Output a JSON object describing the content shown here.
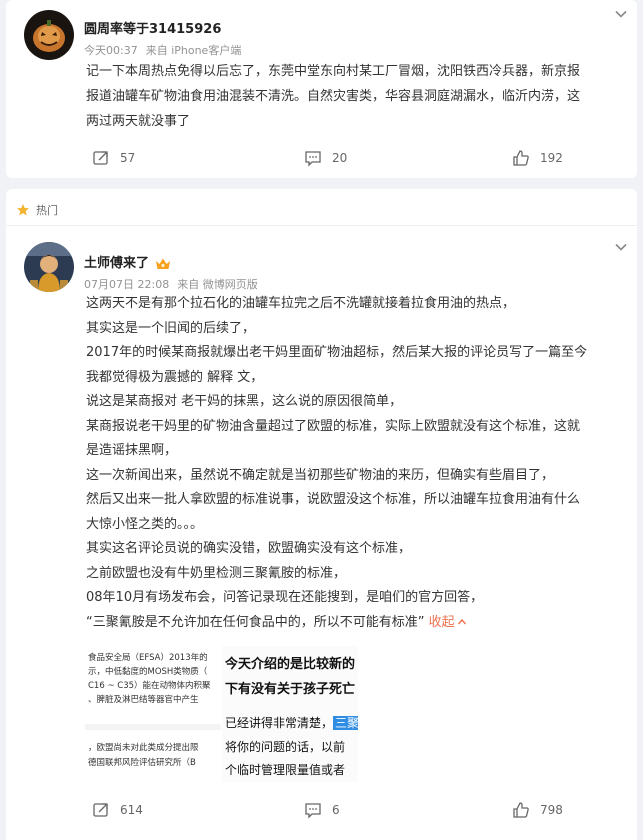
{
  "post1": {
    "username": "圆周率等于31415926",
    "time": "今天00:37",
    "source": "来自 iPhone客户端",
    "lines": [
      "记一下本周热点免得以后忘了，东莞中堂东向村某工厂冒烟，沈阳铁西冷兵器，新京报",
      "报道油罐车矿物油食用油混装不清洗。自然灾害类，华容县洞庭湖漏水，临沂内涝，这",
      "两过两天就没事了"
    ],
    "repost_count": "57",
    "comment_count": "20",
    "like_count": "192"
  },
  "hot_label": "热门",
  "post2": {
    "username": "土师傅来了",
    "time": "07月07日 22:08",
    "source": "来自 微博网页版",
    "lines": [
      "这两天不是有那个拉石化的油罐车拉完之后不洗罐就接着拉食用油的热点，",
      "其实这是一个旧闻的后续了，",
      "2017年的时候某商报就爆出老干妈里面矿物油超标，然后某大报的评论员写了一篇至今",
      "我都觉得极为震撼的 解释 文，",
      "说这是某商报对 老干妈的抹黑，这么说的原因很简单，",
      "某商报说老干妈里的矿物油含量超过了欧盟的标准，实际上欧盟就没有这个标准，这就",
      "是造谣抹黑啊，",
      "这一次新闻出来，虽然说不确定就是当初那些矿物油的来历，但确实有些眉目了，",
      "然后又出来一批人拿欧盟的标准说事，说欧盟没这个标准，所以油罐车拉食用油有什么",
      "大惊小怪之类的。。。",
      "其实这名评论员说的确实没错，欧盟确实没有这个标准，",
      "之前欧盟也没有牛奶里检测三聚氰胺的标准，",
      "08年10月有场发布会，问答记录现在还能搜到，是咱们的官方回答，"
    ],
    "last_line": "“三聚氰胺是不允许加在任何食品中的，所以不可能有标准”",
    "collapse_label": "收起",
    "image1_lines": [
      "食品安全局（EFSA）2013年的",
      "示，中低黏度的MOSH类物质（",
      "C16 ~ C35）能在动物体内积聚",
      "、脾脏及淋巴结等器官中产生",
      "，欧盟尚未对此类成分提出限",
      "德国联邦风险评估研究所（B"
    ],
    "image2_lines": [
      "今天介绍的是比较新的",
      "下有没有关于孩子死亡",
      "已经讲得非常清楚，",
      "三聚",
      "将你的问题的话，以前",
      "个临时管理限量值或者"
    ],
    "repost_count": "614",
    "comment_count": "6",
    "like_count": "798"
  },
  "icons": {
    "repost": "repost-icon",
    "comment": "comment-icon",
    "like": "like-icon",
    "more": "chevron-down-icon",
    "hot": "hot-icon",
    "vip": "vip-crown-icon"
  },
  "colors": {
    "accent": "#eb7350",
    "background": "#f1f2f5",
    "meta": "#939393",
    "highlight": "#2f8de4"
  }
}
